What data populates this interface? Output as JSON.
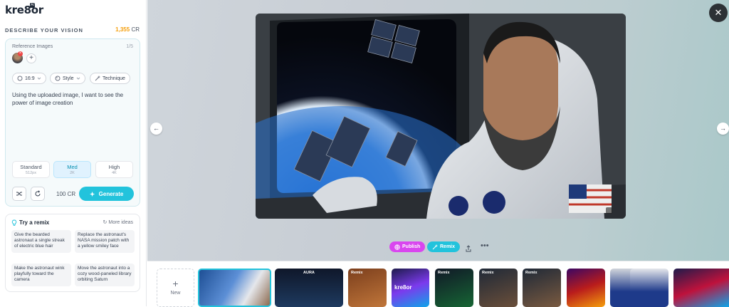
{
  "app": {
    "logo": "kre8or",
    "logo_badge": "AI"
  },
  "sidebar": {
    "describe_label": "DESCRIBE YOUR VISION",
    "credits_value": "1,355",
    "credits_unit": "CR",
    "reference": {
      "label": "Reference Images",
      "count": "1/5"
    },
    "options": {
      "aspect": "16:9",
      "style": "Style",
      "technique": "Technique"
    },
    "prompt": "Using the uploaded image, I want to see the power of image creation",
    "quality": [
      {
        "name": "Standard",
        "sub": "512px"
      },
      {
        "name": "Med",
        "sub": "2K"
      },
      {
        "name": "High",
        "sub": "4K"
      }
    ],
    "quality_selected": "Med",
    "cost": "100 CR",
    "generate_label": "Generate",
    "remix": {
      "title": "Try a remix",
      "more_ideas": "More ideas",
      "ideas": [
        "Give the bearded astronaut a single streak of electric blue hair",
        "Replace the astronaut's NASA mission patch with a yellow smiley face",
        "Make the astronaut wink playfully toward the camera",
        "Move the astronaut into a cozy wood-paneled library orbiting Saturn"
      ]
    }
  },
  "viewer": {
    "close_icon": "close-icon",
    "prev_icon": "arrow-left-icon",
    "next_icon": "arrow-right-icon",
    "publish_label": "Publish",
    "remix_label": "Remix",
    "colors": {
      "publish": "#d946ef",
      "remix": "#22c3dc",
      "accent": "#22c3dc",
      "credits": "#f59e0b"
    }
  },
  "strip": {
    "new_label": "New",
    "tiles": [
      {
        "label": "",
        "selected": true
      },
      {
        "label": "AURA",
        "selected": false
      },
      {
        "label": "Remix",
        "selected": false
      },
      {
        "label": "kre8or",
        "selected": false
      },
      {
        "label": "Remix",
        "selected": false
      },
      {
        "label": "Remix",
        "selected": false
      },
      {
        "label": "Remix",
        "selected": false
      },
      {
        "label": "",
        "selected": false
      },
      {
        "label": "",
        "selected": false
      },
      {
        "label": "",
        "selected": false
      },
      {
        "label": "",
        "selected": false
      }
    ]
  }
}
